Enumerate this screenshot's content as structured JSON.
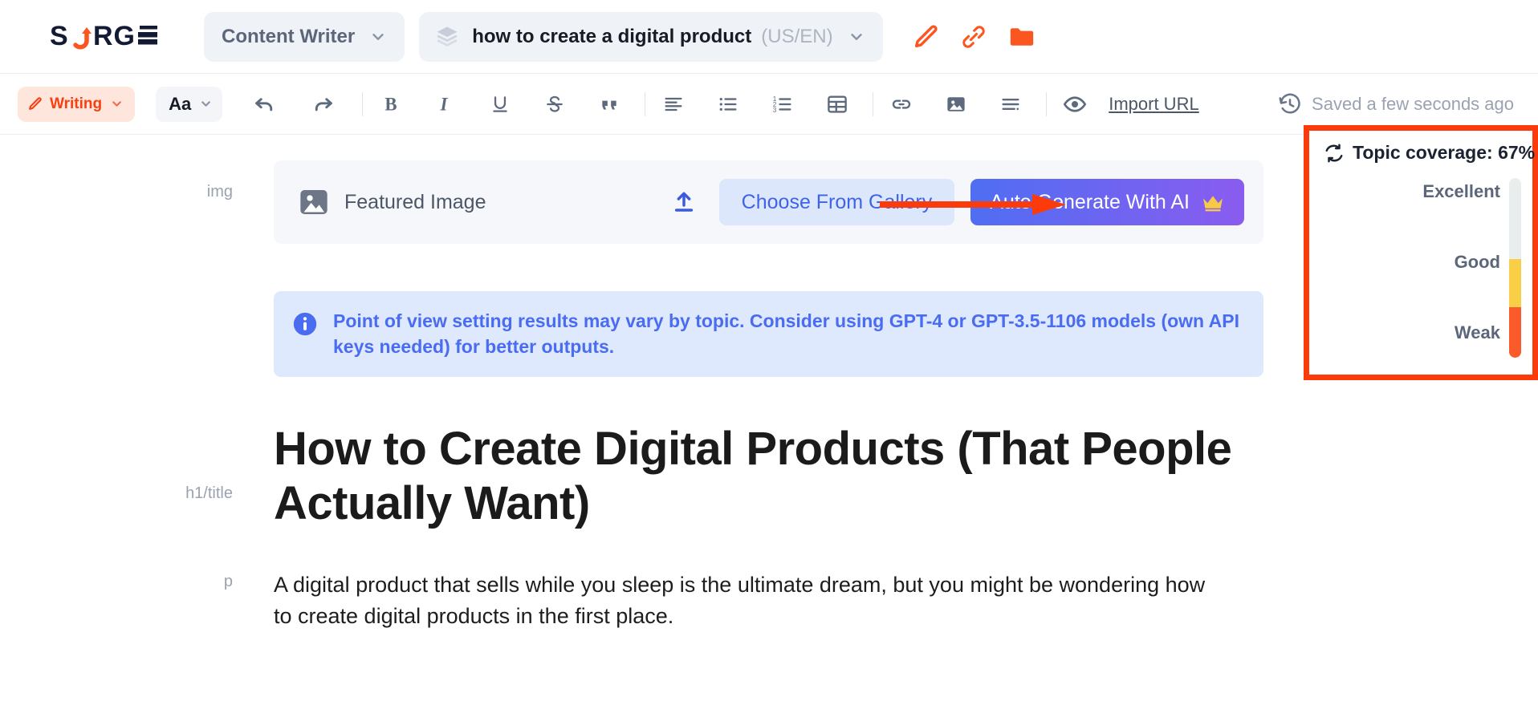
{
  "brand": {
    "name": "SURGE"
  },
  "topbar": {
    "mode_selector": {
      "label": "Content Writer",
      "icon": "chevron-down-icon"
    },
    "document": {
      "icon": "layers-stack-icon",
      "title": "how to create a digital product",
      "locale": "(US/EN)",
      "chevron": "chevron-down-icon"
    },
    "actions": [
      {
        "name": "edit-pencil-icon",
        "label": "Edit"
      },
      {
        "name": "link-attachment-icon",
        "label": "Link"
      },
      {
        "name": "folder-icon",
        "label": "Folder"
      }
    ]
  },
  "toolbar": {
    "mode_button": {
      "label": "Writing",
      "icon": "pencil-icon",
      "chevron": "chevron-down-icon"
    },
    "font_button": {
      "label": "Aa",
      "chevron": "chevron-down-icon"
    },
    "format_icons": [
      "undo-icon",
      "redo-icon",
      "bold-icon",
      "italic-icon",
      "underline-icon",
      "strikethrough-icon",
      "blockquote-icon",
      "align-left-icon",
      "bullet-list-icon",
      "numbered-list-icon",
      "table-icon",
      "link-icon",
      "image-icon",
      "paragraph-options-icon",
      "eye-preview-icon"
    ],
    "import_url_label": "Import URL",
    "saved_status": {
      "icon": "history-clock-icon",
      "text": "Saved a few seconds ago"
    }
  },
  "editor": {
    "gutter_labels": {
      "image": "img",
      "heading": "h1/title",
      "paragraph": "p"
    },
    "featured_image": {
      "icon": "image-placeholder-icon",
      "label": "Featured Image",
      "upload_icon": "upload-icon",
      "gallery_button": "Choose From Gallery",
      "ai_button": "Auto Generate With AI",
      "ai_badge_icon": "crown-icon"
    },
    "notice": {
      "icon": "info-circle-icon",
      "text": "Point of view setting results may vary by topic. Consider using GPT-4 or GPT-3.5-1106 models (own API keys needed) for better outputs."
    },
    "heading": "How to Create Digital Products (That People Actually Want)",
    "paragraph": "A digital product that sells while you sleep is the ultimate dream, but you might be wondering how to create digital products in the first place."
  },
  "coverage_panel": {
    "refresh_icon": "refresh-icon",
    "title": "Topic coverage: 67%",
    "value_percent": 67,
    "scale_labels": {
      "top": "Excellent",
      "middle": "Good",
      "bottom": "Weak"
    },
    "gauge_segments": [
      {
        "label": "Excellent",
        "color": "#e8eeed",
        "share": 45
      },
      {
        "label": "Good",
        "color": "#f8cf47",
        "share": 27
      },
      {
        "label": "Weak",
        "color": "#fb5a2a",
        "share": 28
      }
    ],
    "annotation": {
      "arrow_color": "#fc3b0c",
      "border_color": "#fc3b0c"
    }
  },
  "colors": {
    "brand_orange": "#fb5620",
    "accent_blue": "#3e63e8",
    "notice_blue": "#4a6cf0",
    "annotation_red": "#fc3b0c"
  }
}
